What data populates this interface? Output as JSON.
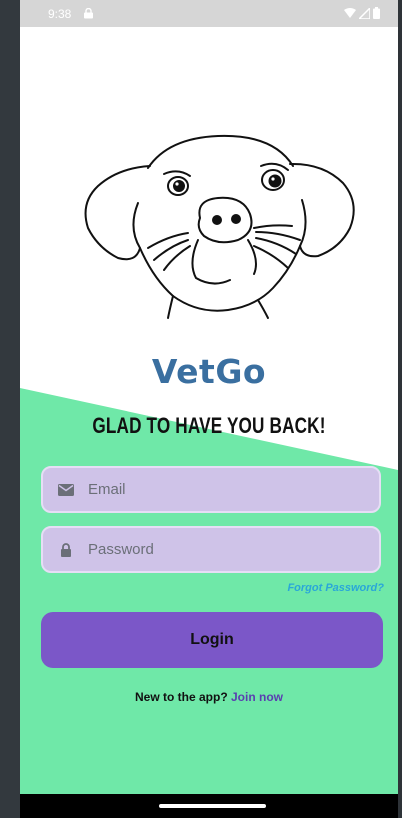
{
  "status_bar": {
    "time": "9:38",
    "lock_icon": "lock-icon",
    "wifi_icon": "wifi-icon",
    "signal_icon": "signal-icon",
    "battery_icon": "battery-icon"
  },
  "colors": {
    "accent_green": "#6fe8a8",
    "field_bg": "#cfc3e8",
    "button_bg": "#7b57c8",
    "title_color": "#3a6fa0",
    "link_color": "#2aa7d8"
  },
  "logo": {
    "icon": "dog-face-icon"
  },
  "app": {
    "title": "VetGo",
    "tagline": "GLAD TO HAVE YOU BACK!"
  },
  "form": {
    "email_placeholder": "Email",
    "email_value": "",
    "email_icon": "mail-icon",
    "password_placeholder": "Password",
    "password_value": "",
    "password_icon": "lock-icon",
    "forgot_label": "Forgot Password?",
    "login_label": "Login"
  },
  "signup": {
    "prompt": "New to the app?",
    "link_label": "Join now"
  }
}
